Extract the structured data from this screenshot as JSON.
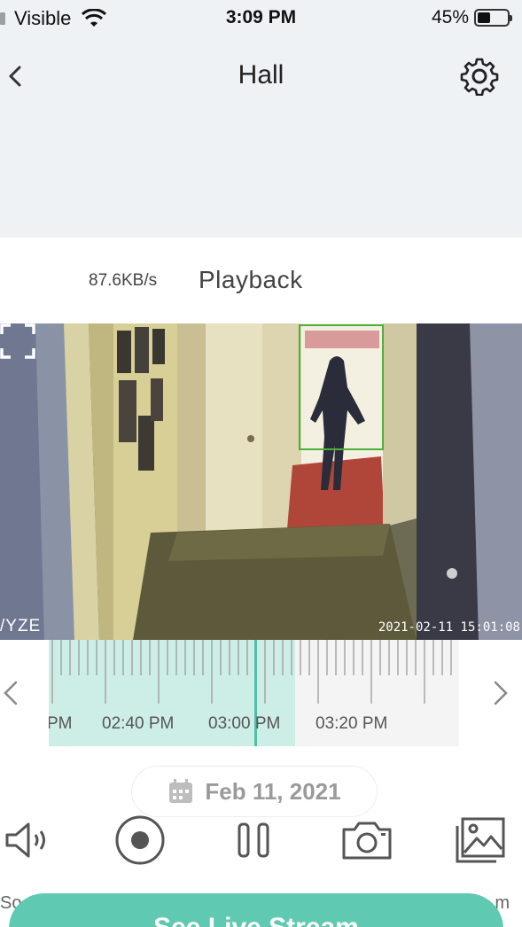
{
  "status_bar": {
    "carrier": "Visible",
    "time": "3:09 PM",
    "battery_percent": "45%",
    "battery_level": 0.45
  },
  "header": {
    "title": "Hall",
    "back_icon": "chevron-left-icon",
    "settings_icon": "gear-icon"
  },
  "playback": {
    "bitrate": "87.6KB/s",
    "mode_label": "Playback"
  },
  "video": {
    "brand_watermark": "/YZE",
    "timestamp": "2021-02-11 15:01:08",
    "fullscreen_icon": "fullscreen-icon",
    "detection_box_color": "#4caf3a"
  },
  "timeline": {
    "labels": [
      "PM",
      "02:40 PM",
      "03:00 PM",
      "03:20 PM"
    ],
    "recorded_fraction": 0.6,
    "cursor_fraction": 0.5,
    "accent": "#5fcab1"
  },
  "date": {
    "label": "Feb 11, 2021",
    "icon": "calendar-icon"
  },
  "controls": {
    "items": [
      {
        "name": "speaker-icon"
      },
      {
        "name": "record-icon"
      },
      {
        "name": "pause-icon"
      },
      {
        "name": "camera-icon"
      },
      {
        "name": "gallery-icon"
      }
    ],
    "left_cut_label": "So",
    "right_cut_label": "m"
  },
  "cta": {
    "label": "See Live Stream"
  }
}
